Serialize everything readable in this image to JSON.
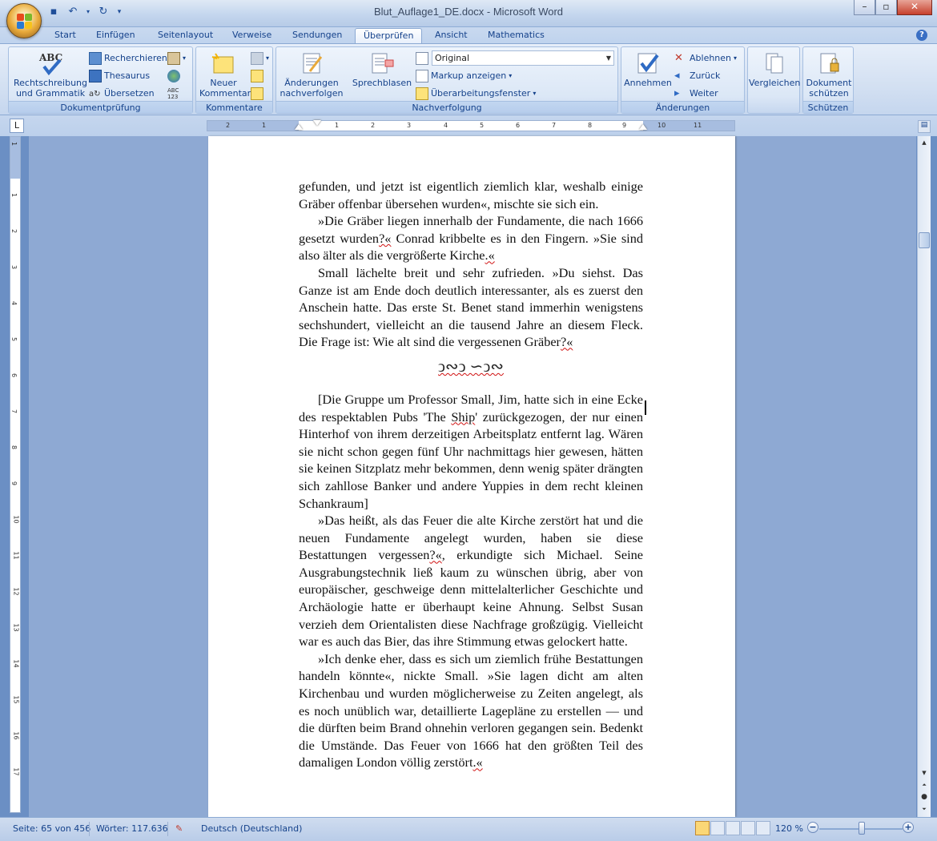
{
  "window": {
    "title": "Blut_Auflage1_DE.docx - Microsoft Word",
    "help_label": "?"
  },
  "tabs": [
    "Start",
    "Einfügen",
    "Seitenlayout",
    "Verweise",
    "Sendungen",
    "Überprüfen",
    "Ansicht",
    "Mathematics"
  ],
  "active_tab": "Überprüfen",
  "ribbon": {
    "dokumentpruefung": {
      "label": "Dokumentprüfung",
      "rechtschreibung": "Rechtschreibung\nund Grammatik",
      "recherchieren": "Recherchieren",
      "thesaurus": "Thesaurus",
      "uebersetzen": "Übersetzen",
      "abc_label": "ABC"
    },
    "kommentare": {
      "label": "Kommentare",
      "neuer_kommentar": "Neuer\nKommentar"
    },
    "nachverfolgung": {
      "label": "Nachverfolgung",
      "aenderungen": "Änderungen\nnachverfolgen",
      "sprechblasen": "Sprechblasen",
      "display_mode": "Original",
      "markup": "Markup anzeigen",
      "ueberarbeitung": "Überarbeitungsfenster"
    },
    "aenderungen": {
      "label": "Änderungen",
      "annehmen": "Annehmen",
      "ablehnen": "Ablehnen",
      "zurueck": "Zurück",
      "weiter": "Weiter"
    },
    "vergleichen": {
      "vergleichen": "Vergleichen"
    },
    "schuetzen": {
      "label": "Schützen",
      "dokument": "Dokument\nschützen"
    }
  },
  "ruler": {
    "tab_selector": "L",
    "h_numbers": [
      "2",
      "1",
      "1",
      "2",
      "3",
      "4",
      "5",
      "6",
      "7",
      "8",
      "9",
      "10",
      "11"
    ],
    "v_numbers": [
      "1",
      "1",
      "2",
      "3",
      "4",
      "5",
      "6",
      "7",
      "8",
      "9",
      "10",
      "11",
      "12",
      "13",
      "14",
      "15",
      "16",
      "17"
    ]
  },
  "document": {
    "p1": "gefunden, und jetzt ist eigentlich ziemlich klar, weshalb einige Gräber offenbar übersehen wurden«, mischte sie sich ein.",
    "p2a": "»Die Gräber liegen innerhalb der Fundamente, die nach 1666 gesetzt wurden",
    "p2b": "?«",
    "p2c": " Conrad kribbelte es in den Fingern. »Sie sind also älter als die vergrößerte Kirche",
    "p2d": ".«",
    "p3a": "Small lächelte breit und sehr zufrieden. »Du siehst. Das Ganze ist am Ende doch deutlich interessanter, als es zuerst den Anschein hatte. Das erste St. Benet stand immerhin wenigstens sechshundert, vielleicht an die tausend Jahre an diesem Fleck. Die Frage ist: Wie alt sind die vergessenen Gräber",
    "p3b": "?«",
    "ornament": "ↄ∾ↄ ∽ↄ∾",
    "p4a": "[Die Gruppe um Professor Small, Jim, hatte sich in eine Ecke des respektablen Pubs 'The ",
    "p4b": "Ship",
    "p4c": "' zurückgezogen, der nur einen Hinterhof von ihrem derzeitigen Arbeitsplatz entfernt lag. Wären sie nicht schon gegen fünf Uhr nachmittags hier gewesen, hätten sie keinen Sitzplatz mehr bekommen, denn wenig später drängten sich zahllose Banker und andere Yuppies in dem recht kleinen Schankraum]",
    "p5a": "»Das heißt, als das Feuer die alte Kirche zerstört hat und die neuen Fundamente angelegt wurden, haben sie diese Bestattungen vergessen",
    "p5b": "?«",
    "p5c": ", erkundigte sich Michael. Seine Ausgrabungstechnik ließ kaum zu wünschen übrig, aber von europäischer, geschweige denn mittelalterlicher Geschichte und Archäologie hatte er überhaupt keine Ahnung. Selbst Susan verzieh dem Orientalisten diese Nachfrage großzügig. Vielleicht war es auch das Bier, das ihre Stimmung etwas gelockert hatte.",
    "p6a": "»Ich denke eher, dass es sich um ziemlich frühe Bestattungen handeln könnte«, nickte Small. »Sie lagen dicht am alten Kirchenbau und wurden möglicherweise zu Zeiten angelegt, als es noch unüblich war, detaillierte Lagepläne zu erstellen — und die dürften beim Brand ohnehin verloren gegangen sein. Bedenkt die Umstände. Das Feuer von 1666 hat den größten Teil des damaligen London völlig zerstört",
    "p6b": ".«"
  },
  "status": {
    "seite": "Seite: 65 von 456",
    "woerter": "Wörter: 117.636",
    "sprache": "Deutsch (Deutschland)",
    "zoom": "120 %",
    "zoom_minus": "−",
    "zoom_plus": "+"
  },
  "colors": {
    "accent": "#15428b",
    "spellcheck": "#d01010"
  }
}
